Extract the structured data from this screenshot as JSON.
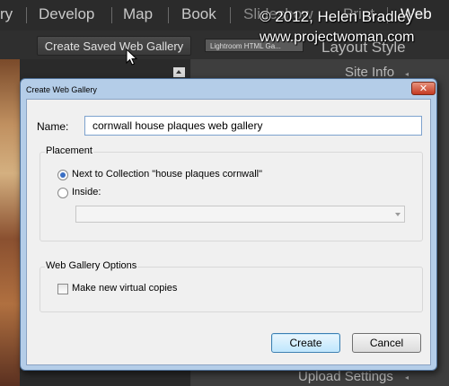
{
  "lightroom": {
    "modules": [
      "ry",
      "Develop",
      "Map",
      "Book",
      "Slideshow",
      "Print",
      "Web"
    ],
    "toolbar": {
      "create_saved_gallery_label": "Create Saved Web Gallery",
      "template_select_value": "Lightroom HTML Ga..."
    },
    "right_panel": {
      "layout_style": "Layout Style",
      "site_info": "Site Info",
      "upload_settings": "Upload Settings"
    }
  },
  "watermark": {
    "line1": "© 2012, Helen Bradley",
    "line2": "www.projectwoman.com"
  },
  "dialog": {
    "title": "Create Web Gallery",
    "close_glyph": "✕",
    "name_label": "Name:",
    "name_value": "cornwall house plaques web gallery",
    "placement": {
      "title": "Placement",
      "option1": "Next to Collection \"house plaques cornwall\"",
      "option2": "Inside:",
      "selected": "option1"
    },
    "options": {
      "title": "Web Gallery Options",
      "virtual_copies": "Make new virtual copies",
      "virtual_copies_checked": false
    },
    "buttons": {
      "create": "Create",
      "cancel": "Cancel"
    }
  },
  "colors": {
    "dialog_frame": "#b4cde8",
    "close_button": "#c53a22",
    "default_button": "#bee6fd",
    "radio_selected": "#3a6fc4"
  },
  "icons": {
    "cursor": "arrow-cursor-icon",
    "close": "close-icon",
    "dropdown": "chevron-down-icon",
    "scroll": "scroll-up-arrow-icon"
  }
}
